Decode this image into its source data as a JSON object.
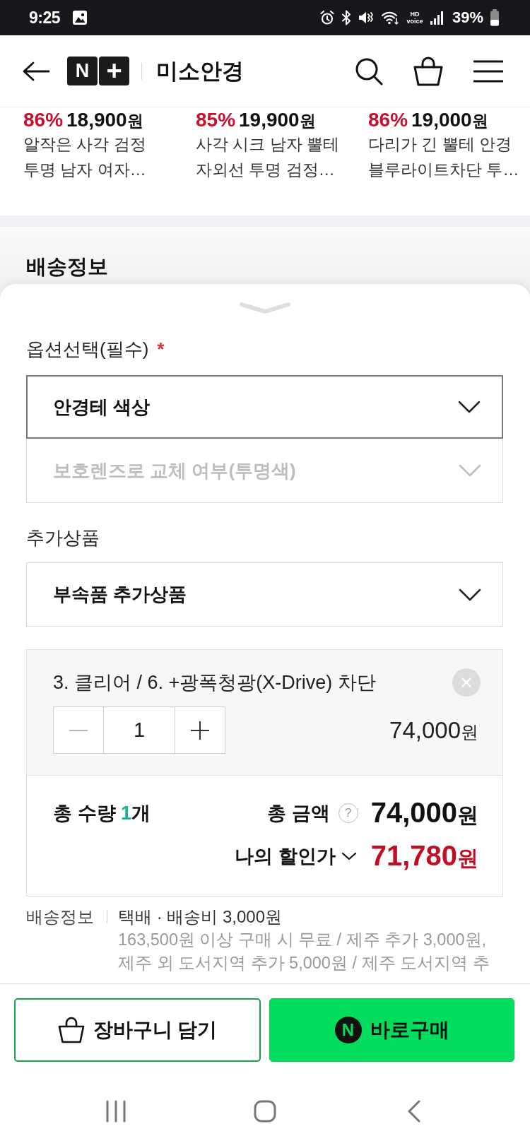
{
  "status_bar": {
    "time": "9:25",
    "hd_voice": "HD voice",
    "battery_text": "39%"
  },
  "header": {
    "logo": [
      {
        "kind": "letter",
        "text": "N"
      },
      {
        "kind": "symbol",
        "text": "+"
      }
    ],
    "title": "미소안경"
  },
  "recommended": [
    {
      "discount": "86%",
      "price": "18,900",
      "unit": "원",
      "name": "알작은 사각 검정 투명 남자 여자…"
    },
    {
      "discount": "85%",
      "price": "19,900",
      "unit": "원",
      "name": "사각 시크 남자 뿔테 자외선 투명 검정…"
    },
    {
      "discount": "86%",
      "price": "19,000",
      "unit": "원",
      "name": "다리가 긴 뿔테 안경 블루라이트차단 투…"
    }
  ],
  "section_heading": "배송정보",
  "sheet": {
    "option_label": "옵션선택(필수)",
    "required_mark": "*",
    "options": [
      {
        "label": "안경테 색상",
        "active": true,
        "disabled": false
      },
      {
        "label": "보호렌즈로 교체 여부(투명색)",
        "active": false,
        "disabled": true
      }
    ],
    "addon_label": "추가상품",
    "addon_select": {
      "label": "부속품 추가상품"
    },
    "selected_item": {
      "name": "3. 클리어 / 6. +광폭청광(X-Drive) 차단",
      "quantity": "1",
      "decrease_disabled": true,
      "price": "74,000",
      "unit": "원"
    },
    "totals": {
      "quantity_label": "총 수량",
      "quantity": "1",
      "quantity_unit": "개",
      "amount_label": "총 금액",
      "help": "?",
      "amount": "74,000",
      "amount_unit": "원",
      "discount_label": "나의 할인가",
      "discount_price": "71,780",
      "discount_unit": "원"
    },
    "shipping": {
      "label": "배송정보",
      "method": "택배 · 배송비 3,000원",
      "detail": "163,500원 이상 구매 시 무료 / 제주 추가 3,000원, 제주 외 도서지역 추가 5,000원 / 제주 도서지역 추"
    }
  },
  "actions": {
    "cart": "장바구니 담기",
    "buy_badge": "N",
    "buy": "바로구매"
  }
}
